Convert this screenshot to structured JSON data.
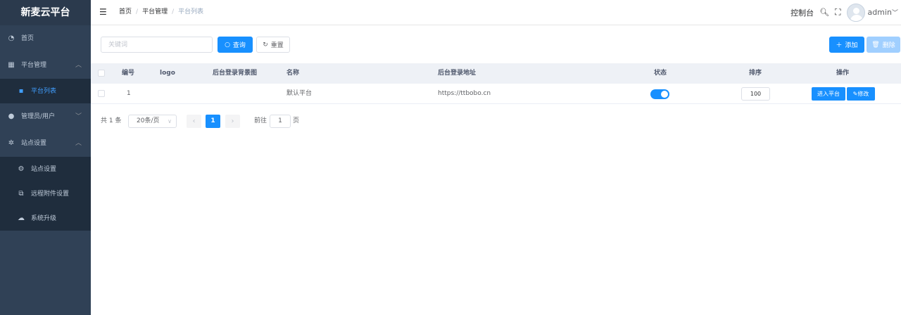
{
  "app": {
    "title": "新麦云平台"
  },
  "sidebar": {
    "items": [
      {
        "label": "首页",
        "icon": "dashboard-icon"
      },
      {
        "label": "平台管理",
        "icon": "grid-icon",
        "expanded": true,
        "children": [
          {
            "label": "平台列表",
            "icon": "apps-icon",
            "active": true
          }
        ]
      },
      {
        "label": "管理员/用户",
        "icon": "user-icon",
        "expanded": false
      },
      {
        "label": "站点设置",
        "icon": "gear-icon",
        "expanded": true,
        "children": [
          {
            "label": "站点设置",
            "icon": "site-gear-icon"
          },
          {
            "label": "远程附件设置",
            "icon": "attachment-icon"
          },
          {
            "label": "系统升级",
            "icon": "cloud-upload-icon"
          }
        ]
      }
    ]
  },
  "header": {
    "breadcrumb": [
      "首页",
      "平台管理",
      "平台列表"
    ],
    "console_label": "控制台",
    "user_name": "admin"
  },
  "toolbar": {
    "search_placeholder": "关键词",
    "search_value": "",
    "query_label": "查询",
    "reset_label": "重置",
    "add_label": "添加",
    "delete_label": "删除"
  },
  "table": {
    "columns": [
      "编号",
      "logo",
      "后台登录背景图",
      "名称",
      "后台登录地址",
      "状态",
      "排序",
      "操作"
    ],
    "rows": [
      {
        "id": "1",
        "logo": "",
        "bg": "",
        "name": "默认平台",
        "url": "https://ttbobo.cn",
        "status": true,
        "sort": "100",
        "enter_label": "进入平台",
        "edit_label": "修改"
      }
    ]
  },
  "pagination": {
    "total_text": "共 1 条",
    "page_size": "20条/页",
    "current_page": "1",
    "goto_prefix": "前往",
    "goto_value": "1",
    "goto_suffix": "页"
  },
  "colors": {
    "primary": "#1890ff",
    "sidebar_bg": "#304156",
    "submenu_bg": "#1f2d3d",
    "active_text": "#409eff"
  }
}
